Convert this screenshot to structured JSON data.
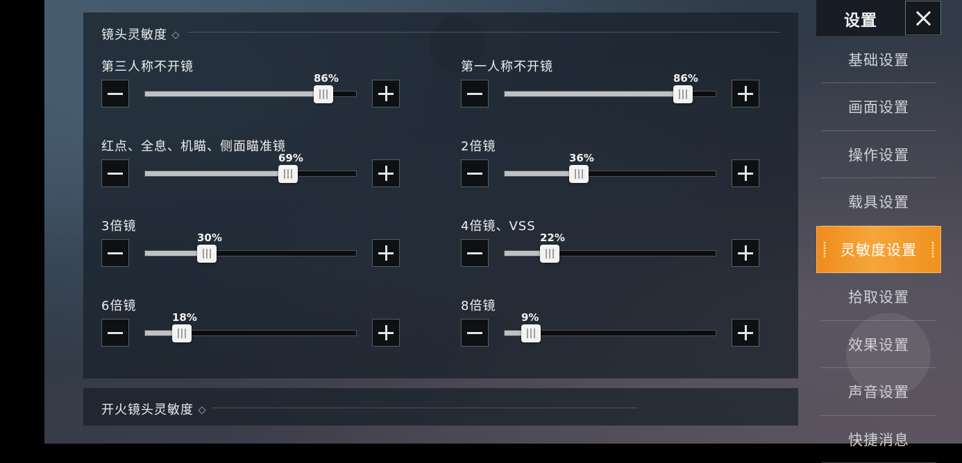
{
  "sidebar": {
    "title": "设置",
    "items": [
      {
        "label": "基础设置",
        "active": false
      },
      {
        "label": "画面设置",
        "active": false
      },
      {
        "label": "操作设置",
        "active": false
      },
      {
        "label": "载具设置",
        "active": false
      },
      {
        "label": "灵敏度设置",
        "active": true
      },
      {
        "label": "拾取设置",
        "active": false
      },
      {
        "label": "效果设置",
        "active": false
      },
      {
        "label": "声音设置",
        "active": false
      },
      {
        "label": "快捷消息",
        "active": false
      }
    ]
  },
  "section1": {
    "title": "镜头灵敏度",
    "sliders": [
      {
        "label": "第三人称不开镜",
        "value": 86,
        "value_text": "86%"
      },
      {
        "label": "第一人称不开镜",
        "value": 86,
        "value_text": "86%"
      },
      {
        "label": "红点、全息、机瞄、侧面瞄准镜",
        "value": 69,
        "value_text": "69%"
      },
      {
        "label": "2倍镜",
        "value": 36,
        "value_text": "36%"
      },
      {
        "label": "3倍镜",
        "value": 30,
        "value_text": "30%"
      },
      {
        "label": "4倍镜、VSS",
        "value": 22,
        "value_text": "22%"
      },
      {
        "label": "6倍镜",
        "value": 18,
        "value_text": "18%"
      },
      {
        "label": "8倍镜",
        "value": 9,
        "value_text": "9%"
      }
    ]
  },
  "section2": {
    "title": "开火镜头灵敏度"
  },
  "colors": {
    "accent": "#f39a2b",
    "slider_fill": "#bfc2c4"
  },
  "icons": {
    "close": "close-icon",
    "minus": "minus-icon",
    "plus": "plus-icon"
  }
}
